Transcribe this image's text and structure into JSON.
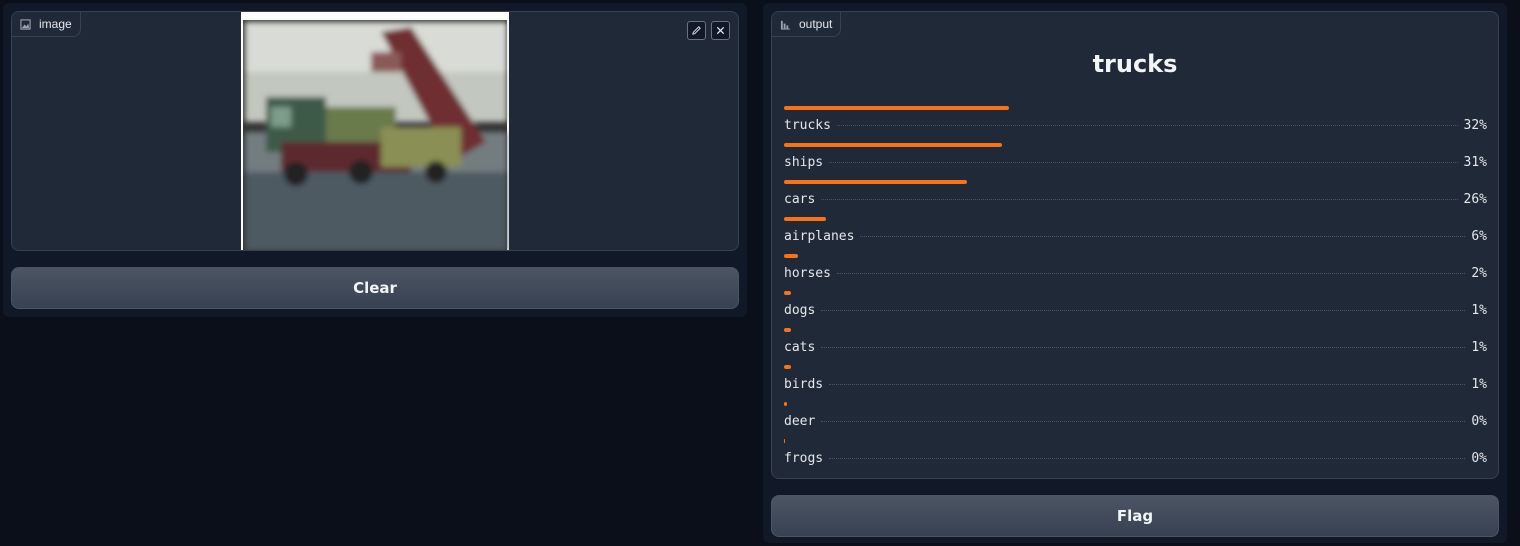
{
  "input": {
    "label": "image",
    "icon": "image-icon",
    "edit_icon": "pencil-icon",
    "close_icon": "close-icon",
    "clear_label": "Clear"
  },
  "output": {
    "label": "output",
    "icon": "chart-icon",
    "top_class": "trucks",
    "flag_label": "Flag",
    "confidences": [
      {
        "label": "trucks",
        "pct": "32%",
        "value": 0.32
      },
      {
        "label": "ships",
        "pct": "31%",
        "value": 0.31
      },
      {
        "label": "cars",
        "pct": "26%",
        "value": 0.26
      },
      {
        "label": "airplanes",
        "pct": "6%",
        "value": 0.06
      },
      {
        "label": "horses",
        "pct": "2%",
        "value": 0.02
      },
      {
        "label": "dogs",
        "pct": "1%",
        "value": 0.01
      },
      {
        "label": "cats",
        "pct": "1%",
        "value": 0.01
      },
      {
        "label": "birds",
        "pct": "1%",
        "value": 0.01
      },
      {
        "label": "deer",
        "pct": "0%",
        "value": 0.004
      },
      {
        "label": "frogs",
        "pct": "0%",
        "value": 0.002
      }
    ]
  },
  "colors": {
    "bar": "#f97316",
    "background": "#0b0f19",
    "panel": "#1f2937"
  }
}
